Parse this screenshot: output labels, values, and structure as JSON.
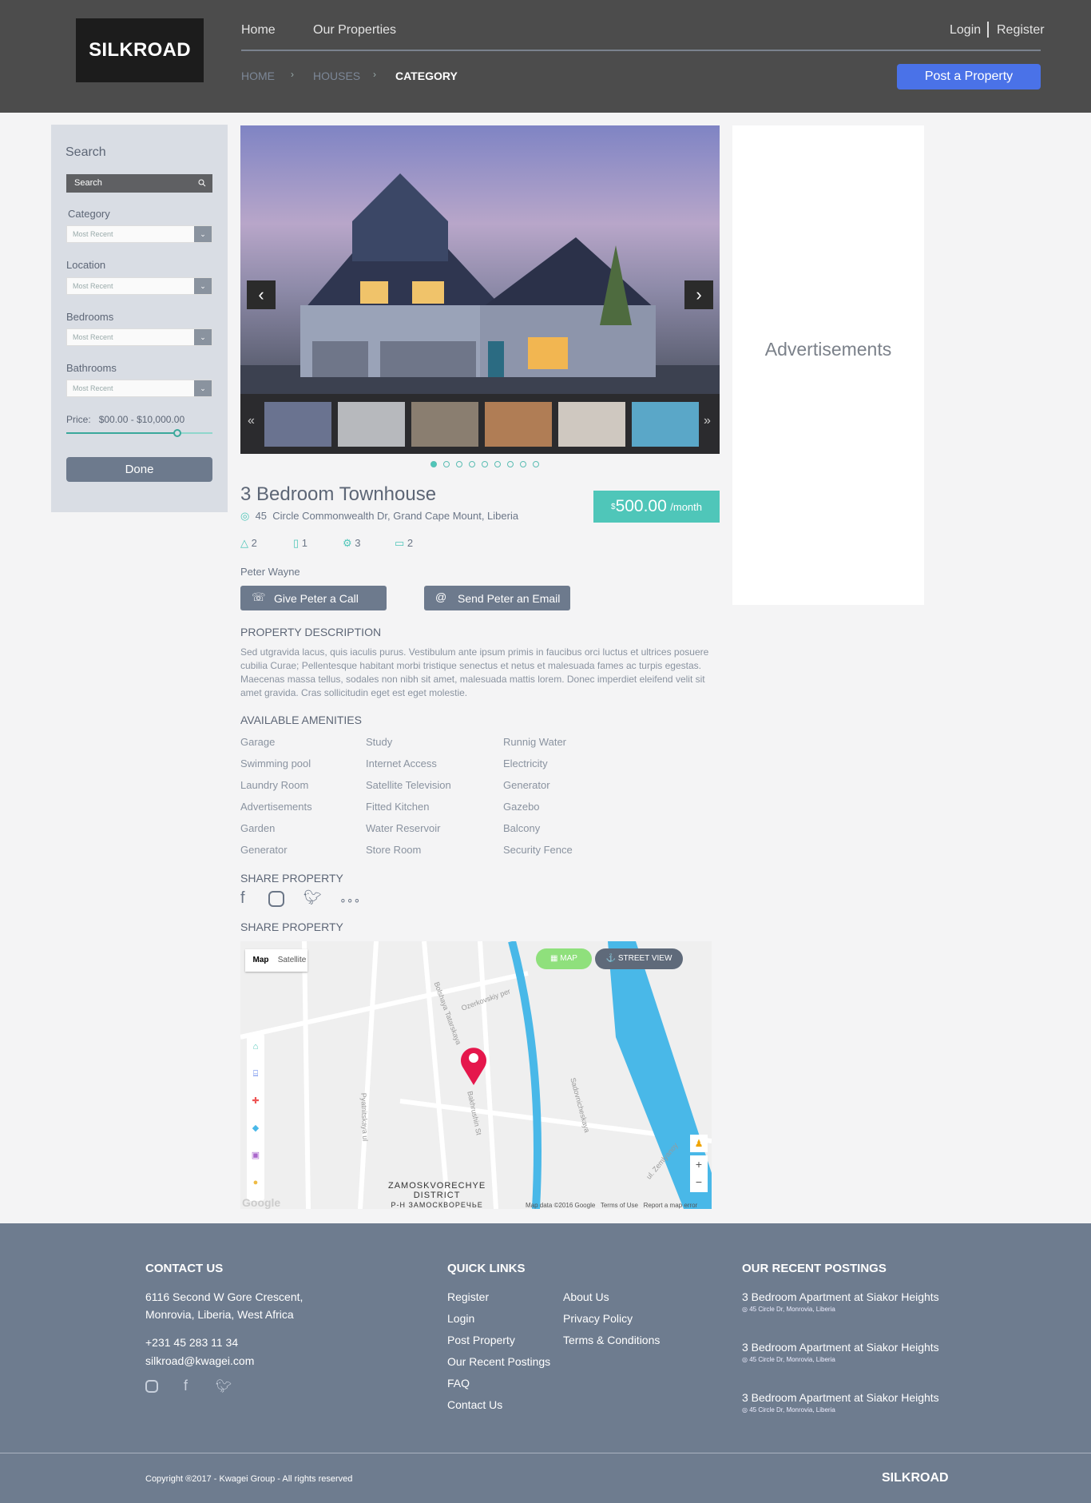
{
  "header": {
    "logo": "SILKROAD",
    "nav": [
      "Home",
      "Our Properties"
    ],
    "login": "Login",
    "register": "Register",
    "breadcrumb": [
      "HOME",
      "HOUSES",
      "CATEGORY"
    ],
    "post_button": "Post a Property"
  },
  "sidebar": {
    "title": "Search",
    "search_placeholder": "Search",
    "filters": [
      {
        "label": "Category",
        "value": "Most Recent"
      },
      {
        "label": "Location",
        "value": "Most Recent"
      },
      {
        "label": "Bedrooms",
        "value": "Most Recent"
      },
      {
        "label": "Bathrooms",
        "value": "Most Recent"
      }
    ],
    "price_label": "Price:",
    "price_range": "$00.00 - $10,000.00",
    "price_slider_fraction": 0.76,
    "done": "Done"
  },
  "listing": {
    "title": "3 Bedroom Townhouse",
    "address_number": "45",
    "address": "Circle Commonwealth Dr, Grand Cape Mount, Liberia",
    "price_currency": "$",
    "price": "500.00",
    "price_unit": "/month",
    "stats": [
      {
        "icon": "area-icon",
        "value": "2"
      },
      {
        "icon": "book-icon",
        "value": "1"
      },
      {
        "icon": "gear-icon",
        "value": "3"
      },
      {
        "icon": "monitor-icon",
        "value": "2"
      }
    ],
    "agent": "Peter Wayne",
    "call_button": "Give Peter a Call",
    "email_button": "Send Peter an Email",
    "description_heading": "PROPERTY DESCRIPTION",
    "description": "Sed utgravida lacus, quis iaculis purus. Vestibulum ante ipsum primis in faucibus orci luctus et ultrices posuere cubilia Curae; Pellentesque habitant morbi tristique senectus et netus et malesuada fames ac turpis egestas. Maecenas massa tellus, sodales non nibh sit amet, malesuada mattis lorem. Donec imperdiet eleifend velit sit amet gravida. Cras sollicitudin eget est eget molestie.",
    "amenities_heading": "AVAILABLE AMENITIES",
    "amenities": [
      [
        "Garage",
        "Study",
        "Runnig Water"
      ],
      [
        "Swimming pool",
        "Internet Access",
        "Electricity"
      ],
      [
        "Laundry Room",
        "Satellite Television",
        "Generator"
      ],
      [
        "Advertisements",
        "Fitted Kitchen",
        "Gazebo"
      ],
      [
        "Garden",
        "Water Reservoir",
        "Balcony"
      ],
      [
        "Generator",
        "Store Room",
        "Security Fence"
      ]
    ],
    "share_heading": "SHARE PROPERTY",
    "map_heading": "SHARE PROPERTY"
  },
  "gallery": {
    "thumb_count": 6,
    "dot_count": 9,
    "active_dot": 0
  },
  "ad": {
    "text": "Advertisements"
  },
  "map": {
    "tab_map": "Map",
    "tab_satellite": "Satellite",
    "btn_map": "MAP",
    "btn_street": "STREET VIEW",
    "district": "ZAMOSKVORECHYE",
    "district2": "DISTRICT",
    "district3": "Р-Н ЗАМОСКВОРЕЧЬЕ",
    "footer_data": "Map data ©2016 Google",
    "footer_terms": "Terms of Use",
    "footer_report": "Report a map error",
    "google": "Google",
    "street1": "Ozerkovskiy per",
    "street2": "ul. Zemlyanoy",
    "street3": "Bolshaya Tatarskaya",
    "street4": "Pyatnitskaya ul",
    "street5": "Bakhrushin St",
    "street6": "Sadovnicheskaya"
  },
  "footer": {
    "contact_heading": "CONTACT US",
    "address1": "6116 Second W Gore Crescent,",
    "address2": "Monrovia, Liberia, West Africa",
    "phone": "+231 45 283 11 34",
    "email": "silkroad@kwagei.com",
    "quick_heading": "QUICK LINKS",
    "links_col1": [
      "Register",
      "Login",
      "Post Property",
      "Our Recent Postings",
      "FAQ",
      "Contact Us"
    ],
    "links_col2": [
      "About Us",
      "Privacy Policy",
      "Terms & Conditions"
    ],
    "recent_heading": "OUR RECENT POSTINGS",
    "recent": [
      {
        "title": "3 Bedroom Apartment at Siakor Heights",
        "addr": "45 Circle Dr, Monrovia, Liberia"
      },
      {
        "title": "3 Bedroom Apartment at Siakor Heights",
        "addr": "45 Circle Dr, Monrovia, Liberia"
      },
      {
        "title": "3 Bedroom Apartment at Siakor Heights",
        "addr": "45 Circle Dr, Monrovia, Liberia"
      }
    ],
    "copyright": "Copyright ®2017 - Kwagei Group - All rights reserved",
    "brand": "SILKROAD"
  },
  "colors": {
    "accent": "#4fc6b9",
    "primary_button": "#4a72e8",
    "header_bg": "#4c4c4c",
    "footer_bg": "#6e7c8f"
  }
}
